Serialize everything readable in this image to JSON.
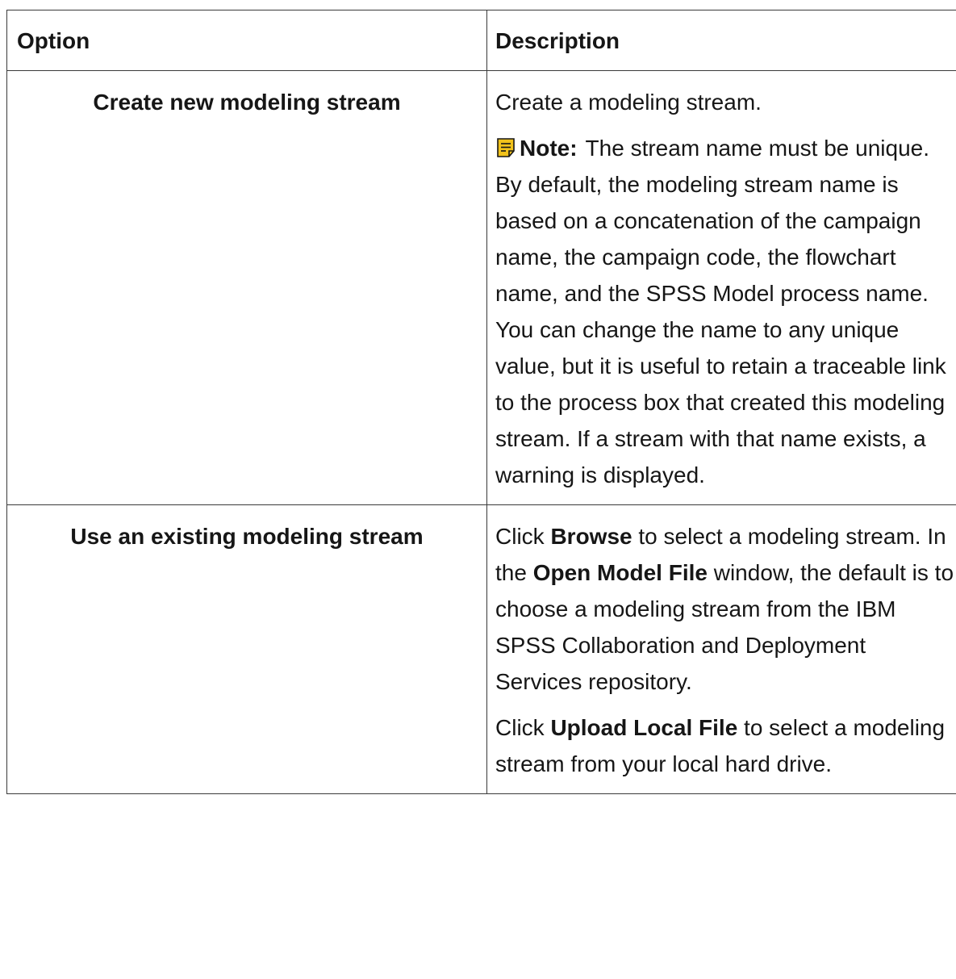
{
  "table": {
    "headers": [
      "Option",
      "Description"
    ],
    "rows": [
      {
        "option": "Create new modeling stream",
        "description_line": "Create a modeling stream.",
        "note_label": "Note:",
        "note_text": "The stream name must be unique. By default, the modeling stream name is based on a concatenation of the campaign name, the campaign code, the flowchart name, and the SPSS Model process name. You can change the name to any unique value, but it is useful to retain a traceable link to the process box that created this modeling stream. If a stream with that name exists, a warning is displayed."
      },
      {
        "option": "Use an existing modeling stream",
        "p1": {
          "t1": "Click",
          "b1": "Browse",
          "t2": "to select a modeling stream. In the",
          "b2": "Open Model File",
          "t3": "window, the default is to choose a modeling stream from the IBM SPSS Collaboration and Deployment Services repository."
        },
        "p2": {
          "t1": "Click",
          "b1": "Upload Local File",
          "t2": "to select a modeling stream from your local hard drive."
        }
      }
    ]
  },
  "colors": {
    "note_icon": "#f1c21b",
    "border": "#3a3a3a",
    "text": "#161616"
  },
  "icons": {
    "note": "note-icon"
  }
}
